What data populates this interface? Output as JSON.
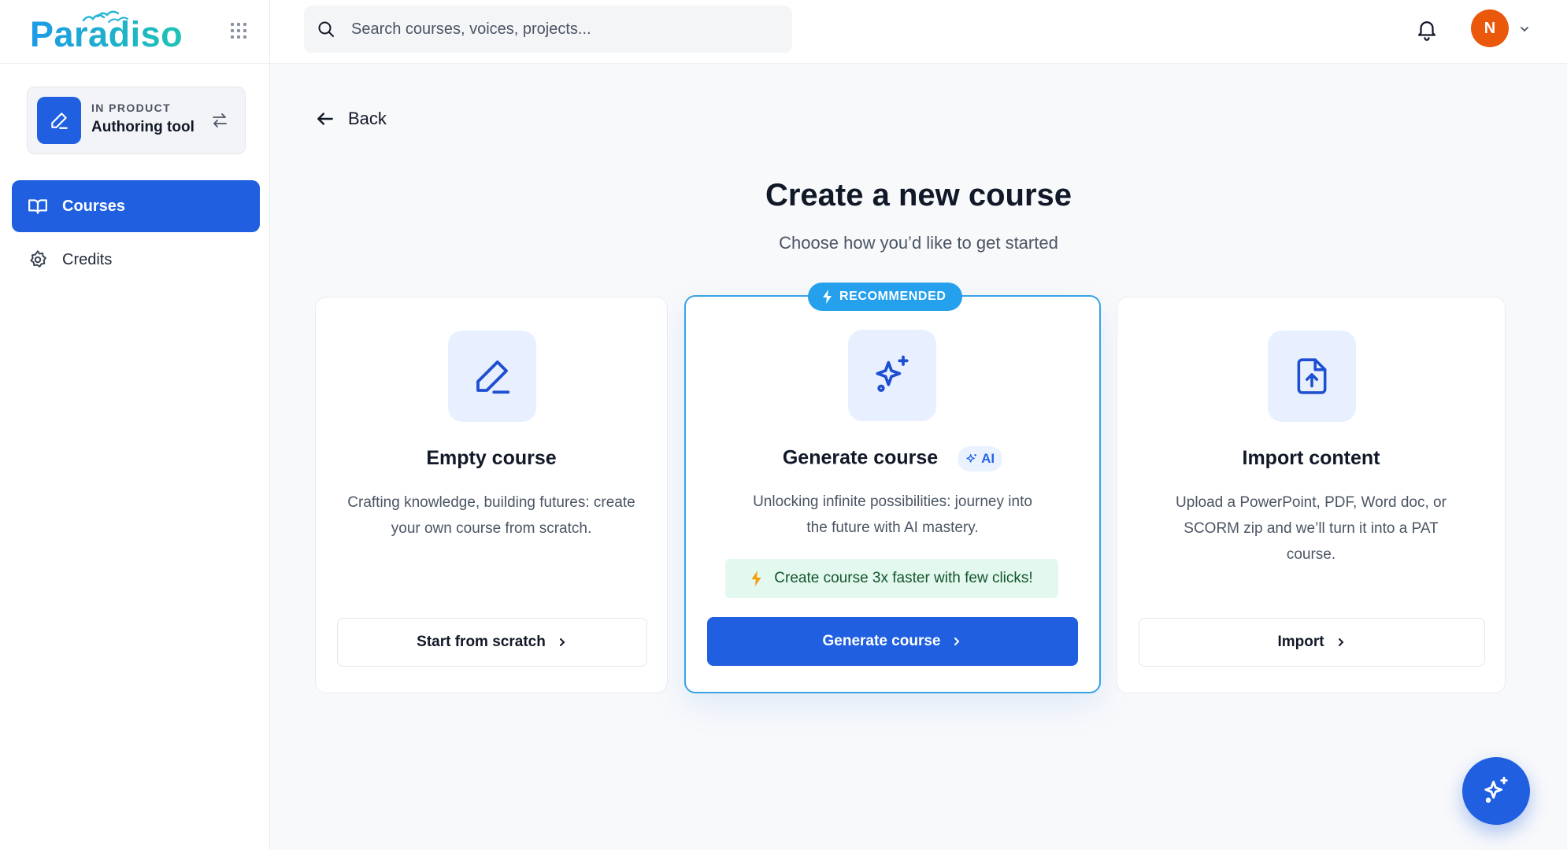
{
  "brand": {
    "name": "Paradiso",
    "accent": "#1f5fe0"
  },
  "product": {
    "kicker": "IN PRODUCT",
    "name": "Authoring tool"
  },
  "sidebar": {
    "items": [
      {
        "label": "Courses",
        "icon": "book-icon",
        "active": true
      },
      {
        "label": "Credits",
        "icon": "gear-icon",
        "active": false
      }
    ]
  },
  "search": {
    "placeholder": "Search courses, voices, projects..."
  },
  "user": {
    "initial": "N",
    "avatar_color": "#ea580c"
  },
  "nav": {
    "back_label": "Back"
  },
  "page": {
    "title": "Create a new course",
    "subtitle": "Choose how you’d like to get started"
  },
  "cards": {
    "empty": {
      "title": "Empty course",
      "description": "Crafting knowledge, building futures: create your own course from scratch.",
      "button": "Start from scratch"
    },
    "generate": {
      "badge": "RECOMMENDED",
      "title": "Generate course",
      "ai_label": "AI",
      "description": "Unlocking infinite possibilities: journey into the future with AI mastery.",
      "promo": "Create course 3x faster with few clicks!",
      "button": "Generate course"
    },
    "import": {
      "title": "Import content",
      "description": "Upload a PowerPoint, PDF, Word doc, or SCORM zip and we’ll turn it into a PAT course.",
      "button": "Import"
    }
  }
}
